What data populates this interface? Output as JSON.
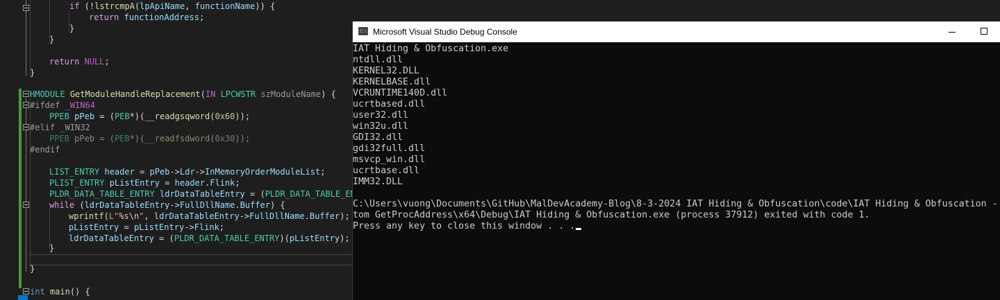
{
  "editor": {
    "lines": [
      {
        "text_parts": [
          [
            "ctl",
            "if"
          ],
          [
            "pl",
            " (!"
          ],
          [
            "fn",
            "lstrcmpA"
          ],
          [
            "pl",
            "("
          ],
          [
            "var",
            "lpApiName"
          ],
          [
            "pl",
            ", "
          ],
          [
            "var",
            "functionName"
          ],
          [
            "pl",
            "))"
          ],
          [
            "pl",
            " {"
          ]
        ]
      },
      {
        "text_parts": [
          [
            "ctl",
            "return"
          ],
          [
            "pl",
            " "
          ],
          [
            "var",
            "functionAddress"
          ],
          [
            "pl",
            ";"
          ]
        ]
      },
      {
        "text_parts": [
          [
            "pl",
            "}"
          ]
        ]
      },
      {
        "text_parts": [
          [
            "pl",
            "}"
          ]
        ]
      },
      {
        "text_parts": [
          [
            "ctl",
            "return"
          ],
          [
            "pl",
            " "
          ],
          [
            "mac",
            "NULL"
          ],
          [
            "pl",
            ";"
          ]
        ]
      },
      {
        "text_parts": [
          [
            "pl",
            "}"
          ]
        ]
      },
      {
        "text_parts": [
          [
            "ty",
            "HMODULE"
          ],
          [
            "pl",
            " "
          ],
          [
            "fn",
            "GetModuleHandleReplacement"
          ],
          [
            "pl",
            "("
          ],
          [
            "mac",
            "IN"
          ],
          [
            "pl",
            " "
          ],
          [
            "ty",
            "LPCWSTR"
          ],
          [
            "pl",
            " "
          ],
          [
            "param",
            "szModuleName"
          ],
          [
            "pl",
            ") {"
          ]
        ]
      },
      {
        "text_parts": [
          [
            "pp",
            "#ifdef "
          ],
          [
            "mac",
            "_WIN64"
          ]
        ]
      },
      {
        "text_parts": [
          [
            "ty",
            "PPEB"
          ],
          [
            "pl",
            " "
          ],
          [
            "var",
            "pPeb"
          ],
          [
            "pl",
            " = ("
          ],
          [
            "ty",
            "PEB"
          ],
          [
            "pl",
            "*)("
          ],
          [
            "fn",
            "__readgsqword"
          ],
          [
            "pl",
            "("
          ],
          [
            "num",
            "0x60"
          ],
          [
            "pl",
            "));"
          ]
        ]
      },
      {
        "text_parts": [
          [
            "pp",
            "#elif "
          ],
          [
            "pp",
            "_WIN32"
          ]
        ]
      },
      {
        "text_parts": [
          [
            "ty",
            "PPEB"
          ],
          [
            "pl",
            " pPeb = ("
          ],
          [
            "ty",
            "PEB"
          ],
          [
            "pl",
            "*)("
          ],
          [
            "fn",
            "__readfsdword"
          ],
          [
            "pl",
            "("
          ],
          [
            "num",
            "0x30"
          ],
          [
            "pl",
            "));"
          ]
        ]
      },
      {
        "text_parts": [
          [
            "pp",
            "#endif"
          ]
        ]
      },
      {
        "text_parts": [
          [
            "ty",
            "LIST_ENTRY"
          ],
          [
            "pl",
            " "
          ],
          [
            "var",
            "header"
          ],
          [
            "pl",
            " = "
          ],
          [
            "var",
            "pPeb"
          ],
          [
            "pl",
            "->"
          ],
          [
            "var",
            "Ldr"
          ],
          [
            "pl",
            "->"
          ],
          [
            "var",
            "InMemoryOrderModuleList"
          ],
          [
            "pl",
            ";"
          ]
        ]
      },
      {
        "text_parts": [
          [
            "ty",
            "PLIST_ENTRY"
          ],
          [
            "pl",
            " "
          ],
          [
            "var",
            "pListEntry"
          ],
          [
            "pl",
            " = "
          ],
          [
            "var",
            "header"
          ],
          [
            "pl",
            "."
          ],
          [
            "var",
            "Flink"
          ],
          [
            "pl",
            ";"
          ]
        ]
      },
      {
        "text_parts": [
          [
            "ty",
            "PLDR_DATA_TABLE_ENTRY"
          ],
          [
            "pl",
            " "
          ],
          [
            "var",
            "ldrDataTableEntry"
          ],
          [
            "pl",
            " = ("
          ],
          [
            "ty",
            "PLDR_DATA_TABLE_ENT"
          ]
        ]
      },
      {
        "text_parts": [
          [
            "ctl",
            "while"
          ],
          [
            "pl",
            " ("
          ],
          [
            "var",
            "ldrDataTableEntry"
          ],
          [
            "pl",
            "->"
          ],
          [
            "var",
            "FullDllName"
          ],
          [
            "pl",
            "."
          ],
          [
            "var",
            "Buffer"
          ],
          [
            "pl",
            ") {"
          ]
        ]
      },
      {
        "text_parts": [
          [
            "fn",
            "wprintf"
          ],
          [
            "pl",
            "("
          ],
          [
            "str",
            "L\""
          ],
          [
            "esc",
            "%s\\n"
          ],
          [
            "str",
            "\""
          ],
          [
            "pl",
            ", "
          ],
          [
            "var",
            "ldrDataTableEntry"
          ],
          [
            "pl",
            "->"
          ],
          [
            "var",
            "FullDllName"
          ],
          [
            "pl",
            "."
          ],
          [
            "var",
            "Buffer"
          ],
          [
            "pl",
            ");"
          ]
        ]
      },
      {
        "text_parts": [
          [
            "var",
            "pListEntry"
          ],
          [
            "pl",
            " = "
          ],
          [
            "var",
            "pListEntry"
          ],
          [
            "pl",
            "->"
          ],
          [
            "var",
            "Flink"
          ],
          [
            "pl",
            ";"
          ]
        ]
      },
      {
        "text_parts": [
          [
            "var",
            "ldrDataTableEntry"
          ],
          [
            "pl",
            " = ("
          ],
          [
            "ty",
            "PLDR_DATA_TABLE_ENTRY"
          ],
          [
            "pl",
            ")("
          ],
          [
            "var",
            "pListEntry"
          ],
          [
            "pl",
            ");"
          ]
        ]
      },
      {
        "text_parts": [
          [
            "pl",
            "}"
          ]
        ]
      },
      {
        "text_parts": [
          [
            "pl",
            ""
          ]
        ]
      },
      {
        "text_parts": [
          [
            "pl",
            "}"
          ]
        ]
      },
      {
        "text_parts": [
          [
            "kw",
            "int"
          ],
          [
            "pl",
            " "
          ],
          [
            "fn",
            "main"
          ],
          [
            "pl",
            "() {"
          ]
        ]
      }
    ]
  },
  "console": {
    "title": "Microsoft Visual Studio Debug Console",
    "icon": "console-app-icon",
    "window_buttons": {
      "minimize": "minimize-icon",
      "maximize": "maximize-icon"
    },
    "output": [
      "IAT Hiding & Obfuscation.exe",
      "ntdll.dll",
      "KERNEL32.DLL",
      "KERNELBASE.dll",
      "VCRUNTIME140D.dll",
      "ucrtbased.dll",
      "user32.dll",
      "win32u.dll",
      "GDI32.dll",
      "gdi32full.dll",
      "msvcp_win.dll",
      "ucrtbase.dll",
      "IMM32.DLL",
      "",
      "C:\\Users\\vuong\\Documents\\GitHub\\MalDevAcademy-Blog\\8-3-2024 IAT Hiding & Obfuscation\\code\\IAT Hiding & Obfuscation -",
      "tom GetProcAddress\\x64\\Debug\\IAT Hiding & Obfuscation.exe (process 37912) exited with code 1.",
      "Press any key to close this window . . ."
    ]
  },
  "colors": {
    "editor_bg": "#1e1e1e",
    "console_bg": "#0c0c0c",
    "change_bar": "#4a9a3a",
    "accent": "#007acc"
  }
}
